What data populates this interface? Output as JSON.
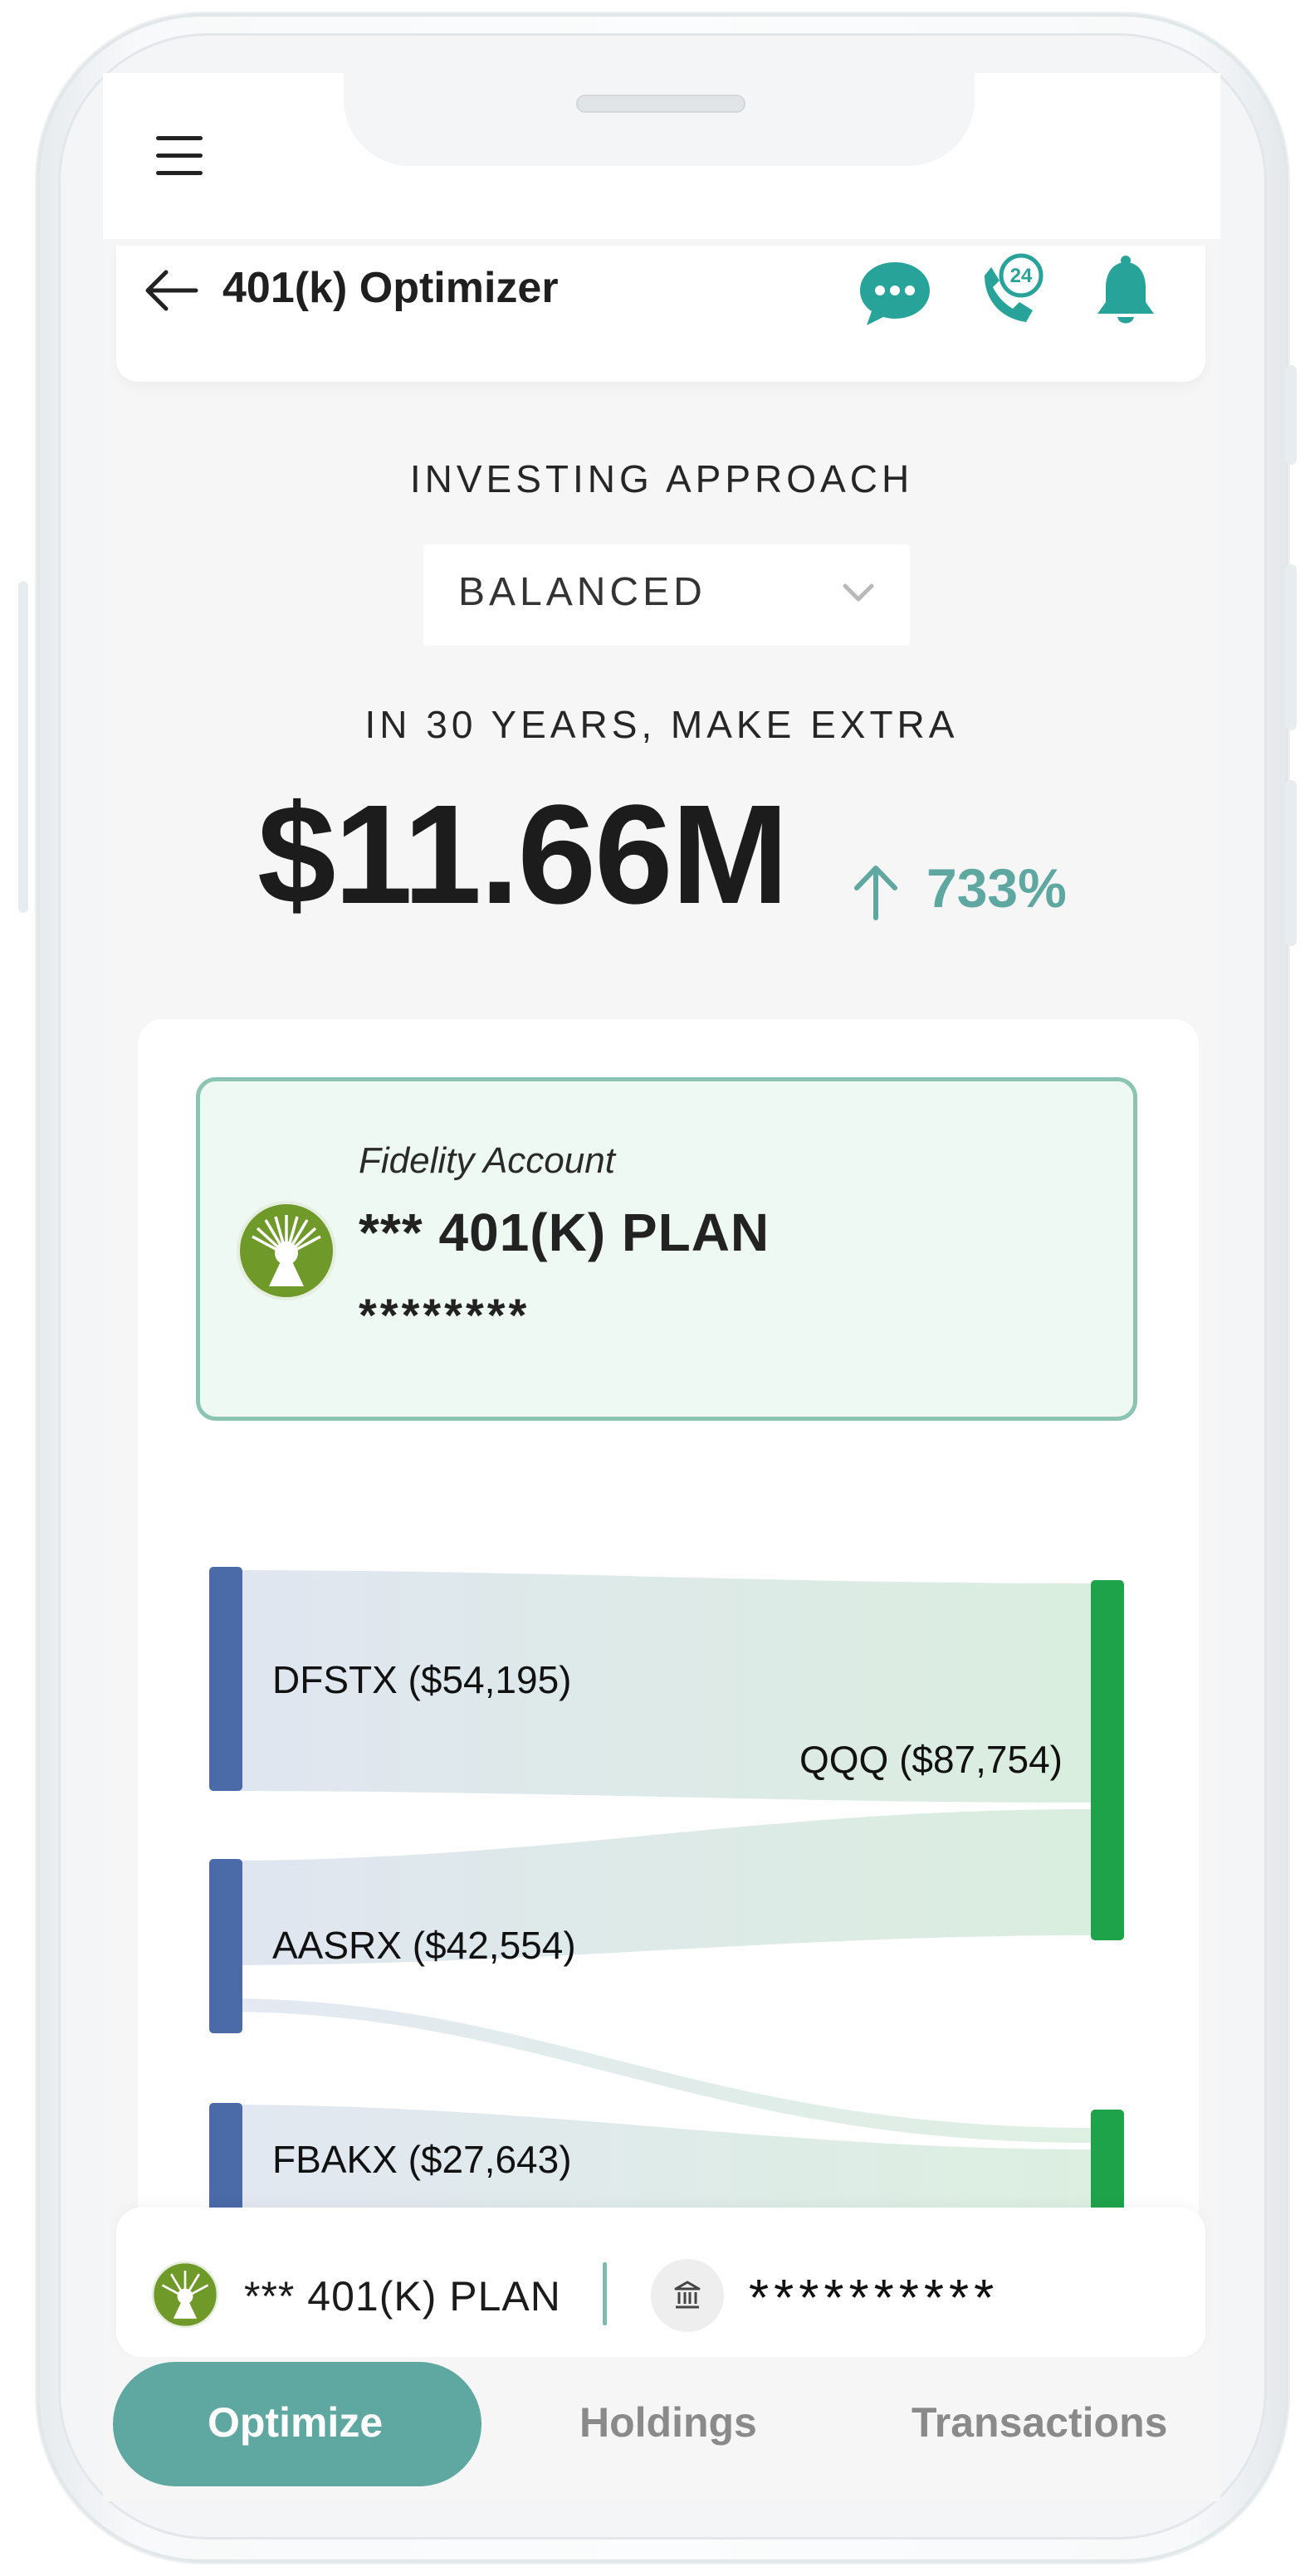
{
  "header": {
    "title": "401(k) Optimizer",
    "icons": [
      "chat-icon",
      "phone-24-icon",
      "bell-icon"
    ],
    "icon_color": "#27a39a"
  },
  "approach": {
    "label": "INVESTING APPROACH",
    "selected": "BALANCED"
  },
  "projection": {
    "label": "IN 30 YEARS, MAKE EXTRA",
    "amount": "$11.66M",
    "change": "733%"
  },
  "account": {
    "provider": "Fidelity Account",
    "name": "*** 401(K) PLAN",
    "number": "********"
  },
  "allocation_flows": {
    "sources": [
      {
        "label": "DFSTX ($54,195)",
        "color": "#4a6aa8"
      },
      {
        "label": "AASRX ($42,554)",
        "color": "#4a6aa8"
      },
      {
        "label": "FBAKX ($27,643)",
        "color": "#4a6aa8"
      }
    ],
    "targets": [
      {
        "label": "QQQ ($87,754)",
        "color": "#1fa34a"
      }
    ]
  },
  "account_bar": {
    "plan": "*** 401(K) PLAN",
    "bank_mask": "**********"
  },
  "tabs": [
    {
      "label": "Optimize",
      "active": true
    },
    {
      "label": "Holdings",
      "active": false
    },
    {
      "label": "Transactions",
      "active": false
    }
  ],
  "colors": {
    "accent": "#5fa7a1",
    "card_border": "#8cc4b4",
    "card_bg": "#eef9f4",
    "source_bar": "#4a6aa8",
    "target_bar": "#1fa34a"
  }
}
